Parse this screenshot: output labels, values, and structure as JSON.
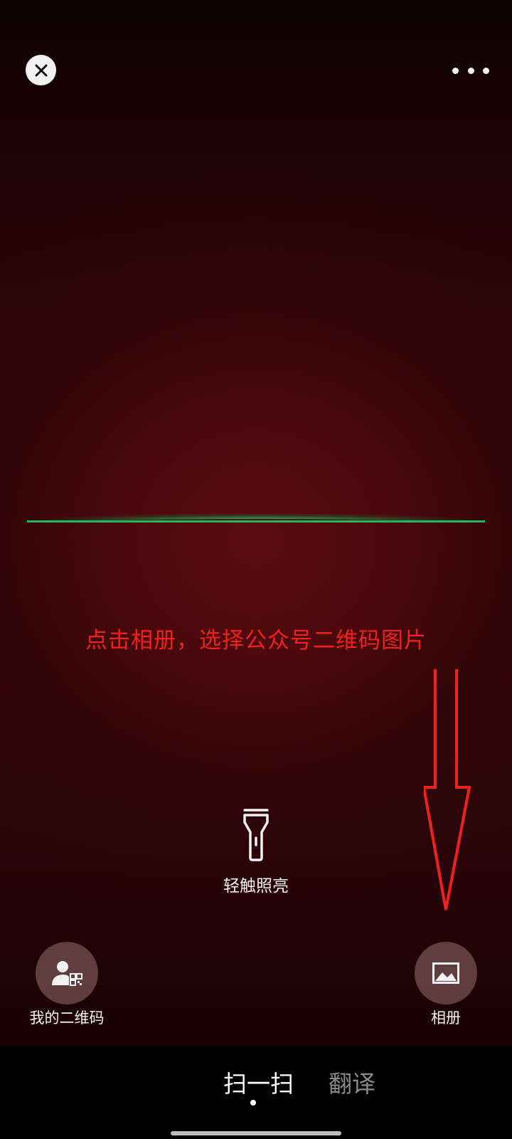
{
  "instruction": "点击相册，选择公众号二维码图片",
  "torch": {
    "label": "轻触照亮",
    "icon": "flashlight-icon"
  },
  "my_qr": {
    "label": "我的二维码",
    "icon": "user-qr-icon"
  },
  "album": {
    "label": "相册",
    "icon": "image-icon"
  },
  "tabs": [
    {
      "label": "扫一扫",
      "active": true
    },
    {
      "label": "翻译",
      "active": false
    }
  ],
  "colors": {
    "annotation": "#ef2020",
    "scan_line": "#1fd56a"
  }
}
